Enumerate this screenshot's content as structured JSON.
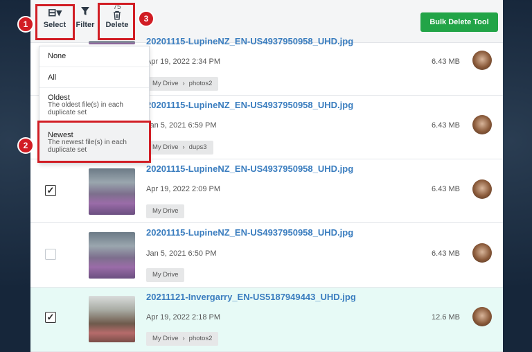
{
  "toolbar": {
    "select_label": "Select",
    "filter_label": "Filter",
    "delete_label": "Delete",
    "delete_count": "75",
    "bulk_delete_label": "Bulk Delete Tool"
  },
  "select_menu": {
    "items": [
      {
        "label": "None",
        "description": ""
      },
      {
        "label": "All",
        "description": ""
      },
      {
        "label": "Oldest",
        "description": "The oldest file(s) in each duplicate set"
      },
      {
        "label": "Newest",
        "description": "The newest file(s) in each duplicate set"
      }
    ]
  },
  "files": [
    {
      "name": "20201115-LupineNZ_EN-US4937950958_UHD.jpg",
      "date": "Apr 19, 2022 2:34 PM",
      "size": "6.43 MB",
      "path": [
        "My Drive",
        "photos2"
      ],
      "checked": false,
      "thumb": "lupine"
    },
    {
      "name": "20201115-LupineNZ_EN-US4937950958_UHD.jpg",
      "date": "Jan 5, 2021 6:59 PM",
      "size": "6.43 MB",
      "path": [
        "My Drive",
        "dups3"
      ],
      "checked": false,
      "thumb": "lupine"
    },
    {
      "name": "20201115-LupineNZ_EN-US4937950958_UHD.jpg",
      "date": "Apr 19, 2022 2:09 PM",
      "size": "6.43 MB",
      "path": [
        "My Drive"
      ],
      "checked": true,
      "thumb": "lupine"
    },
    {
      "name": "20201115-LupineNZ_EN-US4937950958_UHD.jpg",
      "date": "Jan 5, 2021 6:50 PM",
      "size": "6.43 MB",
      "path": [
        "My Drive"
      ],
      "checked": false,
      "thumb": "lupine"
    },
    {
      "name": "20211121-Invergarry_EN-US5187949443_UHD.jpg",
      "date": "Apr 19, 2022 2:18 PM",
      "size": "12.6 MB",
      "path": [
        "My Drive",
        "photos2"
      ],
      "checked": true,
      "thumb": "forest"
    }
  ],
  "annotations": [
    "1",
    "2",
    "3"
  ],
  "colors": {
    "accent_green": "#22a447",
    "link_blue": "#3a7dbf",
    "annotation_red": "#d11d24",
    "selected_row": "#e7faf6"
  },
  "icons": {
    "select": "select-all-icon",
    "filter": "filter-icon",
    "delete": "trash-icon",
    "crumb_separator": "chevron-right-icon"
  }
}
